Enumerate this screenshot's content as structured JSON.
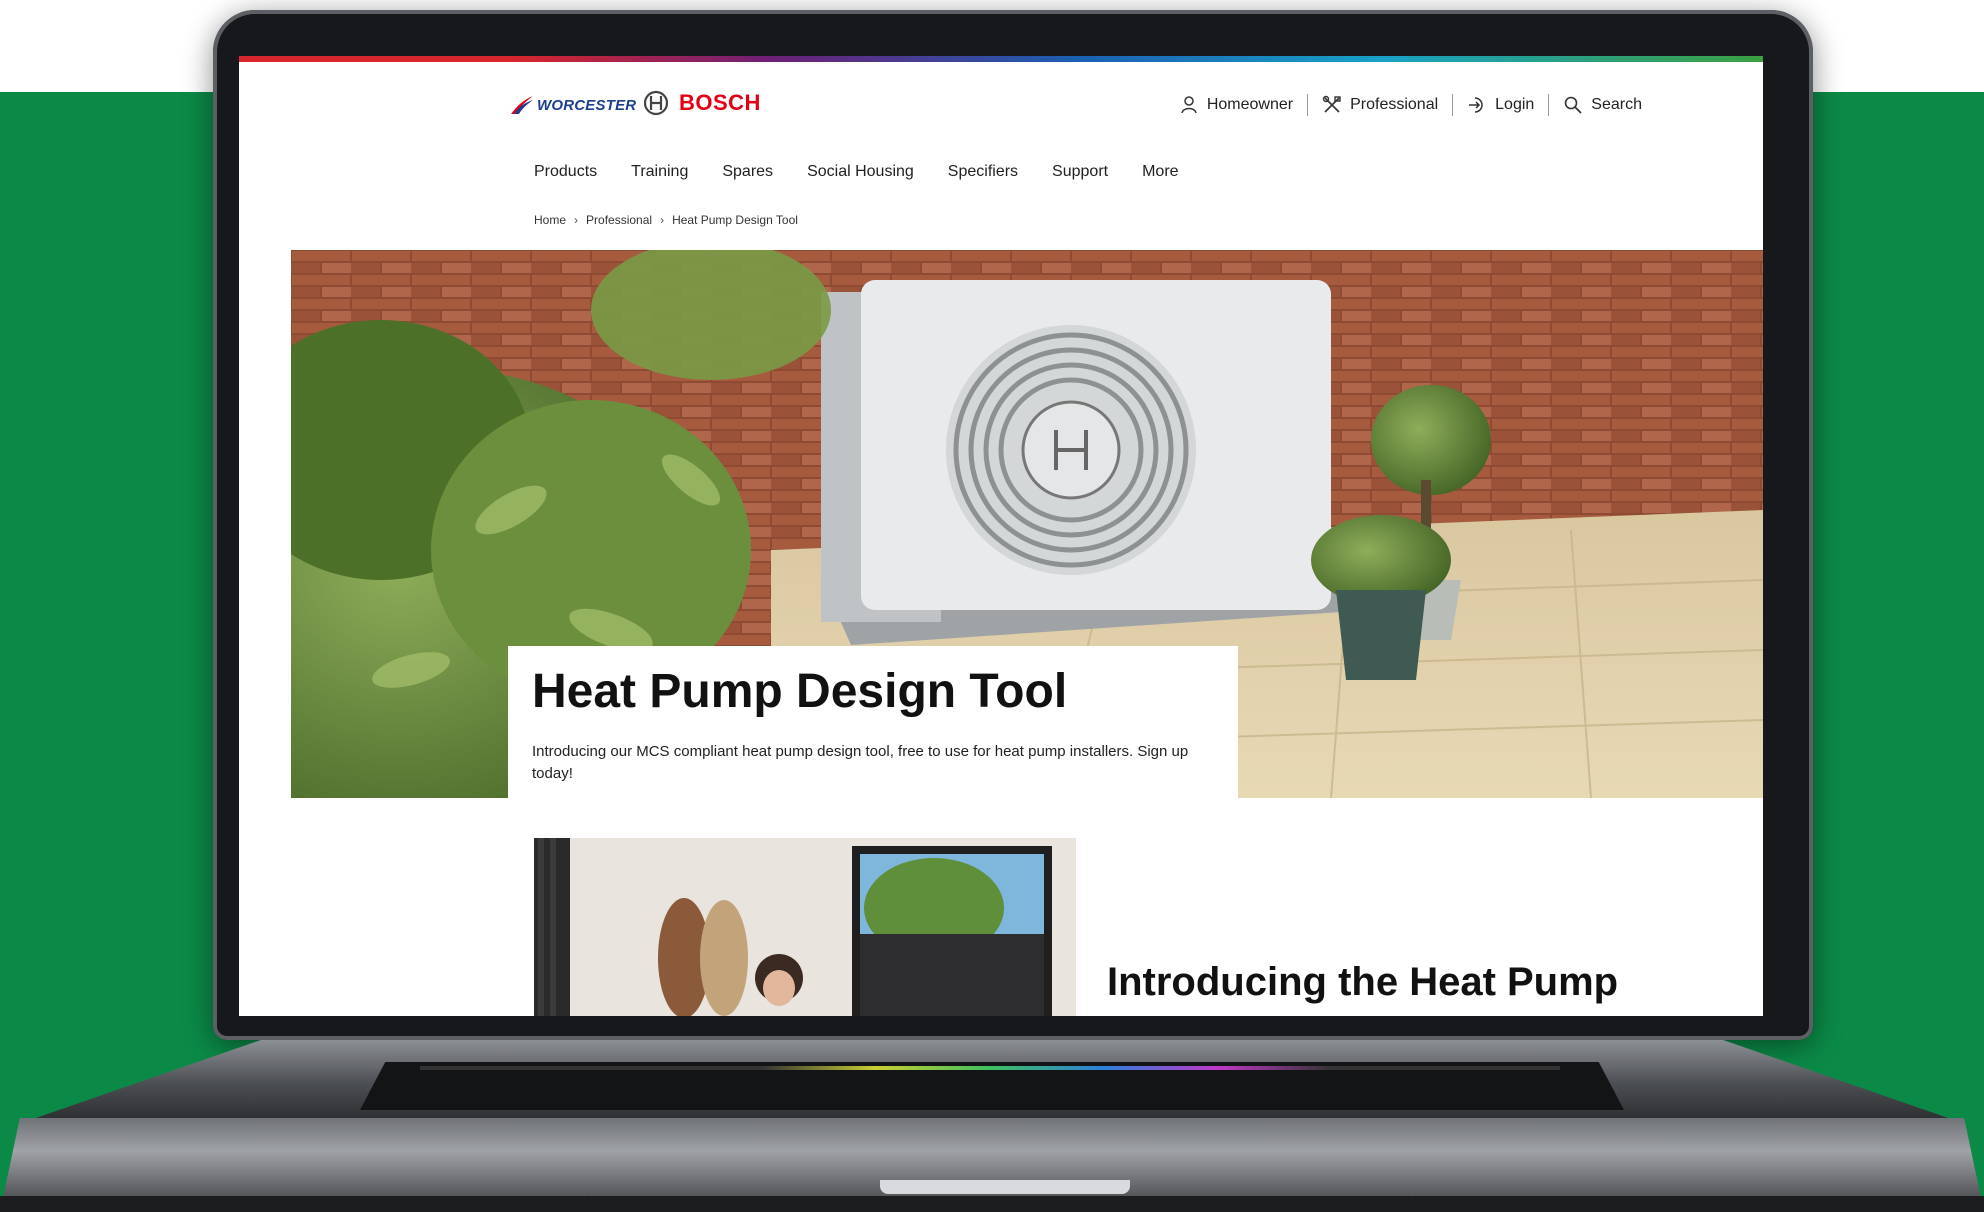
{
  "brand": {
    "worcester": "WORCESTER",
    "bosch": "BOSCH",
    "bosch_red": "#e20015",
    "worcester_blue": "#1d3f8f",
    "background_green": "#0b8a47"
  },
  "utility_nav": [
    {
      "label": "Homeowner",
      "icon": "person-icon"
    },
    {
      "label": "Professional",
      "icon": "tools-icon"
    },
    {
      "label": "Login",
      "icon": "login-icon"
    },
    {
      "label": "Search",
      "icon": "search-icon"
    }
  ],
  "main_nav": [
    "Products",
    "Training",
    "Spares",
    "Social Housing",
    "Specifiers",
    "Support",
    "More"
  ],
  "breadcrumb": [
    "Home",
    "Professional",
    "Heat Pump Design Tool"
  ],
  "breadcrumb_separator": "›",
  "hero": {
    "title": "Heat Pump Design Tool",
    "text": "Introducing our MCS compliant heat pump design tool, free to use for heat pump installers. Sign up today!",
    "unit_badge": "BOSCH"
  },
  "section": {
    "title": "Introducing the Heat Pump"
  }
}
